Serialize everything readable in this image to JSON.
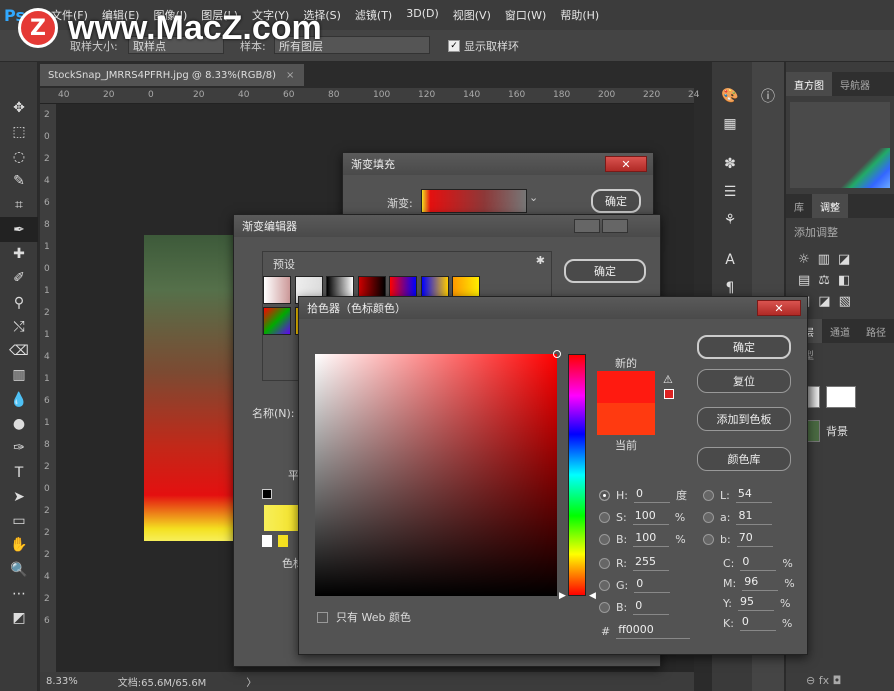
{
  "app": {
    "logo": "Ps",
    "watermark": "www.MacZ.com",
    "watermark_logo": "Z"
  },
  "menu": [
    "文件(F)",
    "编辑(E)",
    "图像(I)",
    "图层(L)",
    "文字(Y)",
    "选择(S)",
    "滤镜(T)",
    "3D(D)",
    "视图(V)",
    "窗口(W)",
    "帮助(H)"
  ],
  "options": {
    "sample_size_label": "取样大小:",
    "sample_size_value": "取样点",
    "sample_label": "样本:",
    "sample_value": "所有图层",
    "show_ring": "显示取样环"
  },
  "document": {
    "tab": "StockSnap_JMRRS4PFRH.jpg @ 8.33%(RGB/8)",
    "close": "×",
    "zoom": "8.33%",
    "doc_info": "文档:65.6M/65.6M",
    "more": "〉"
  },
  "ruler_h": [
    "40",
    "20",
    "0",
    "20",
    "40",
    "60",
    "80",
    "100",
    "120",
    "140",
    "160",
    "180",
    "200",
    "220",
    "24"
  ],
  "ruler_v": [
    "2",
    "0",
    "2",
    "4",
    "6",
    "8",
    "1",
    "0",
    "1",
    "2",
    "1",
    "4",
    "1",
    "6",
    "1",
    "8",
    "2",
    "0",
    "2",
    "2",
    "2",
    "4",
    "2",
    "6"
  ],
  "panels": {
    "histogram_tab": "直方图",
    "navigator_tab": "导航器",
    "library_tab": "库",
    "adjust_tab": "调整",
    "adjust_title": "添加调整",
    "layers_tab": "图层",
    "channels_tab": "通道",
    "paths_tab": "路径",
    "kind": "类型",
    "bg_layer": "背景",
    "footer": "⊖  fx  ◘"
  },
  "gradient_fill": {
    "title": "渐变填充",
    "gradient_label": "渐变:",
    "ok": "确定",
    "close": "✕"
  },
  "gradient_editor": {
    "title": "渐变编辑器",
    "presets_label": "预设",
    "name_label": "名称(N):",
    "ok": "确定",
    "smooth_label": "平",
    "color_label": "色标"
  },
  "color_picker": {
    "title": "拾色器（色标颜色）",
    "new_label": "新的",
    "current_label": "当前",
    "ok": "确定",
    "reset": "复位",
    "add_swatch": "添加到色板",
    "color_libs": "颜色库",
    "web_only": "只有 Web 颜色",
    "close": "✕",
    "H": {
      "label": "H:",
      "value": "0",
      "unit": "度"
    },
    "S": {
      "label": "S:",
      "value": "100",
      "unit": "%"
    },
    "B": {
      "label": "B:",
      "value": "100",
      "unit": "%"
    },
    "R": {
      "label": "R:",
      "value": "255"
    },
    "G": {
      "label": "G:",
      "value": "0"
    },
    "Bb": {
      "label": "B:",
      "value": "0"
    },
    "L": {
      "label": "L:",
      "value": "54"
    },
    "a": {
      "label": "a:",
      "value": "81"
    },
    "b": {
      "label": "b:",
      "value": "70"
    },
    "C": {
      "label": "C:",
      "value": "0",
      "unit": "%"
    },
    "M": {
      "label": "M:",
      "value": "96",
      "unit": "%"
    },
    "Y": {
      "label": "Y:",
      "value": "95",
      "unit": "%"
    },
    "K": {
      "label": "K:",
      "value": "0",
      "unit": "%"
    },
    "hex_label": "#",
    "hex": "ff0000"
  },
  "colors": {
    "new": "#ff1a10",
    "current": "#ff3a10",
    "accent": "#31a8ff"
  }
}
